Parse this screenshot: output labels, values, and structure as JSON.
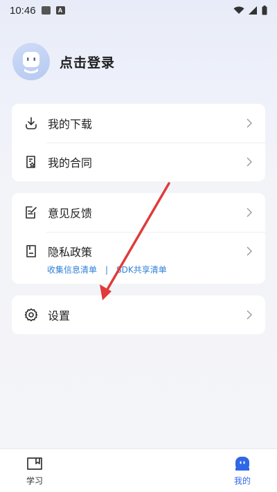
{
  "status_bar": {
    "time": "10:46"
  },
  "profile": {
    "login_label": "点击登录"
  },
  "menu": {
    "downloads": "我的下载",
    "contracts": "我的合同",
    "feedback": "意见反馈",
    "privacy": "隐私政策",
    "privacy_links": {
      "collected_info": "收集信息清单",
      "separator": "|",
      "sdk_share": "SDK共享清单"
    },
    "settings": "设置"
  },
  "bottom_nav": {
    "study": "学习",
    "mine": "我的"
  },
  "colors": {
    "accent": "#2f67e6",
    "link": "#2f7fd8",
    "annotation_arrow": "#e03a3a"
  }
}
